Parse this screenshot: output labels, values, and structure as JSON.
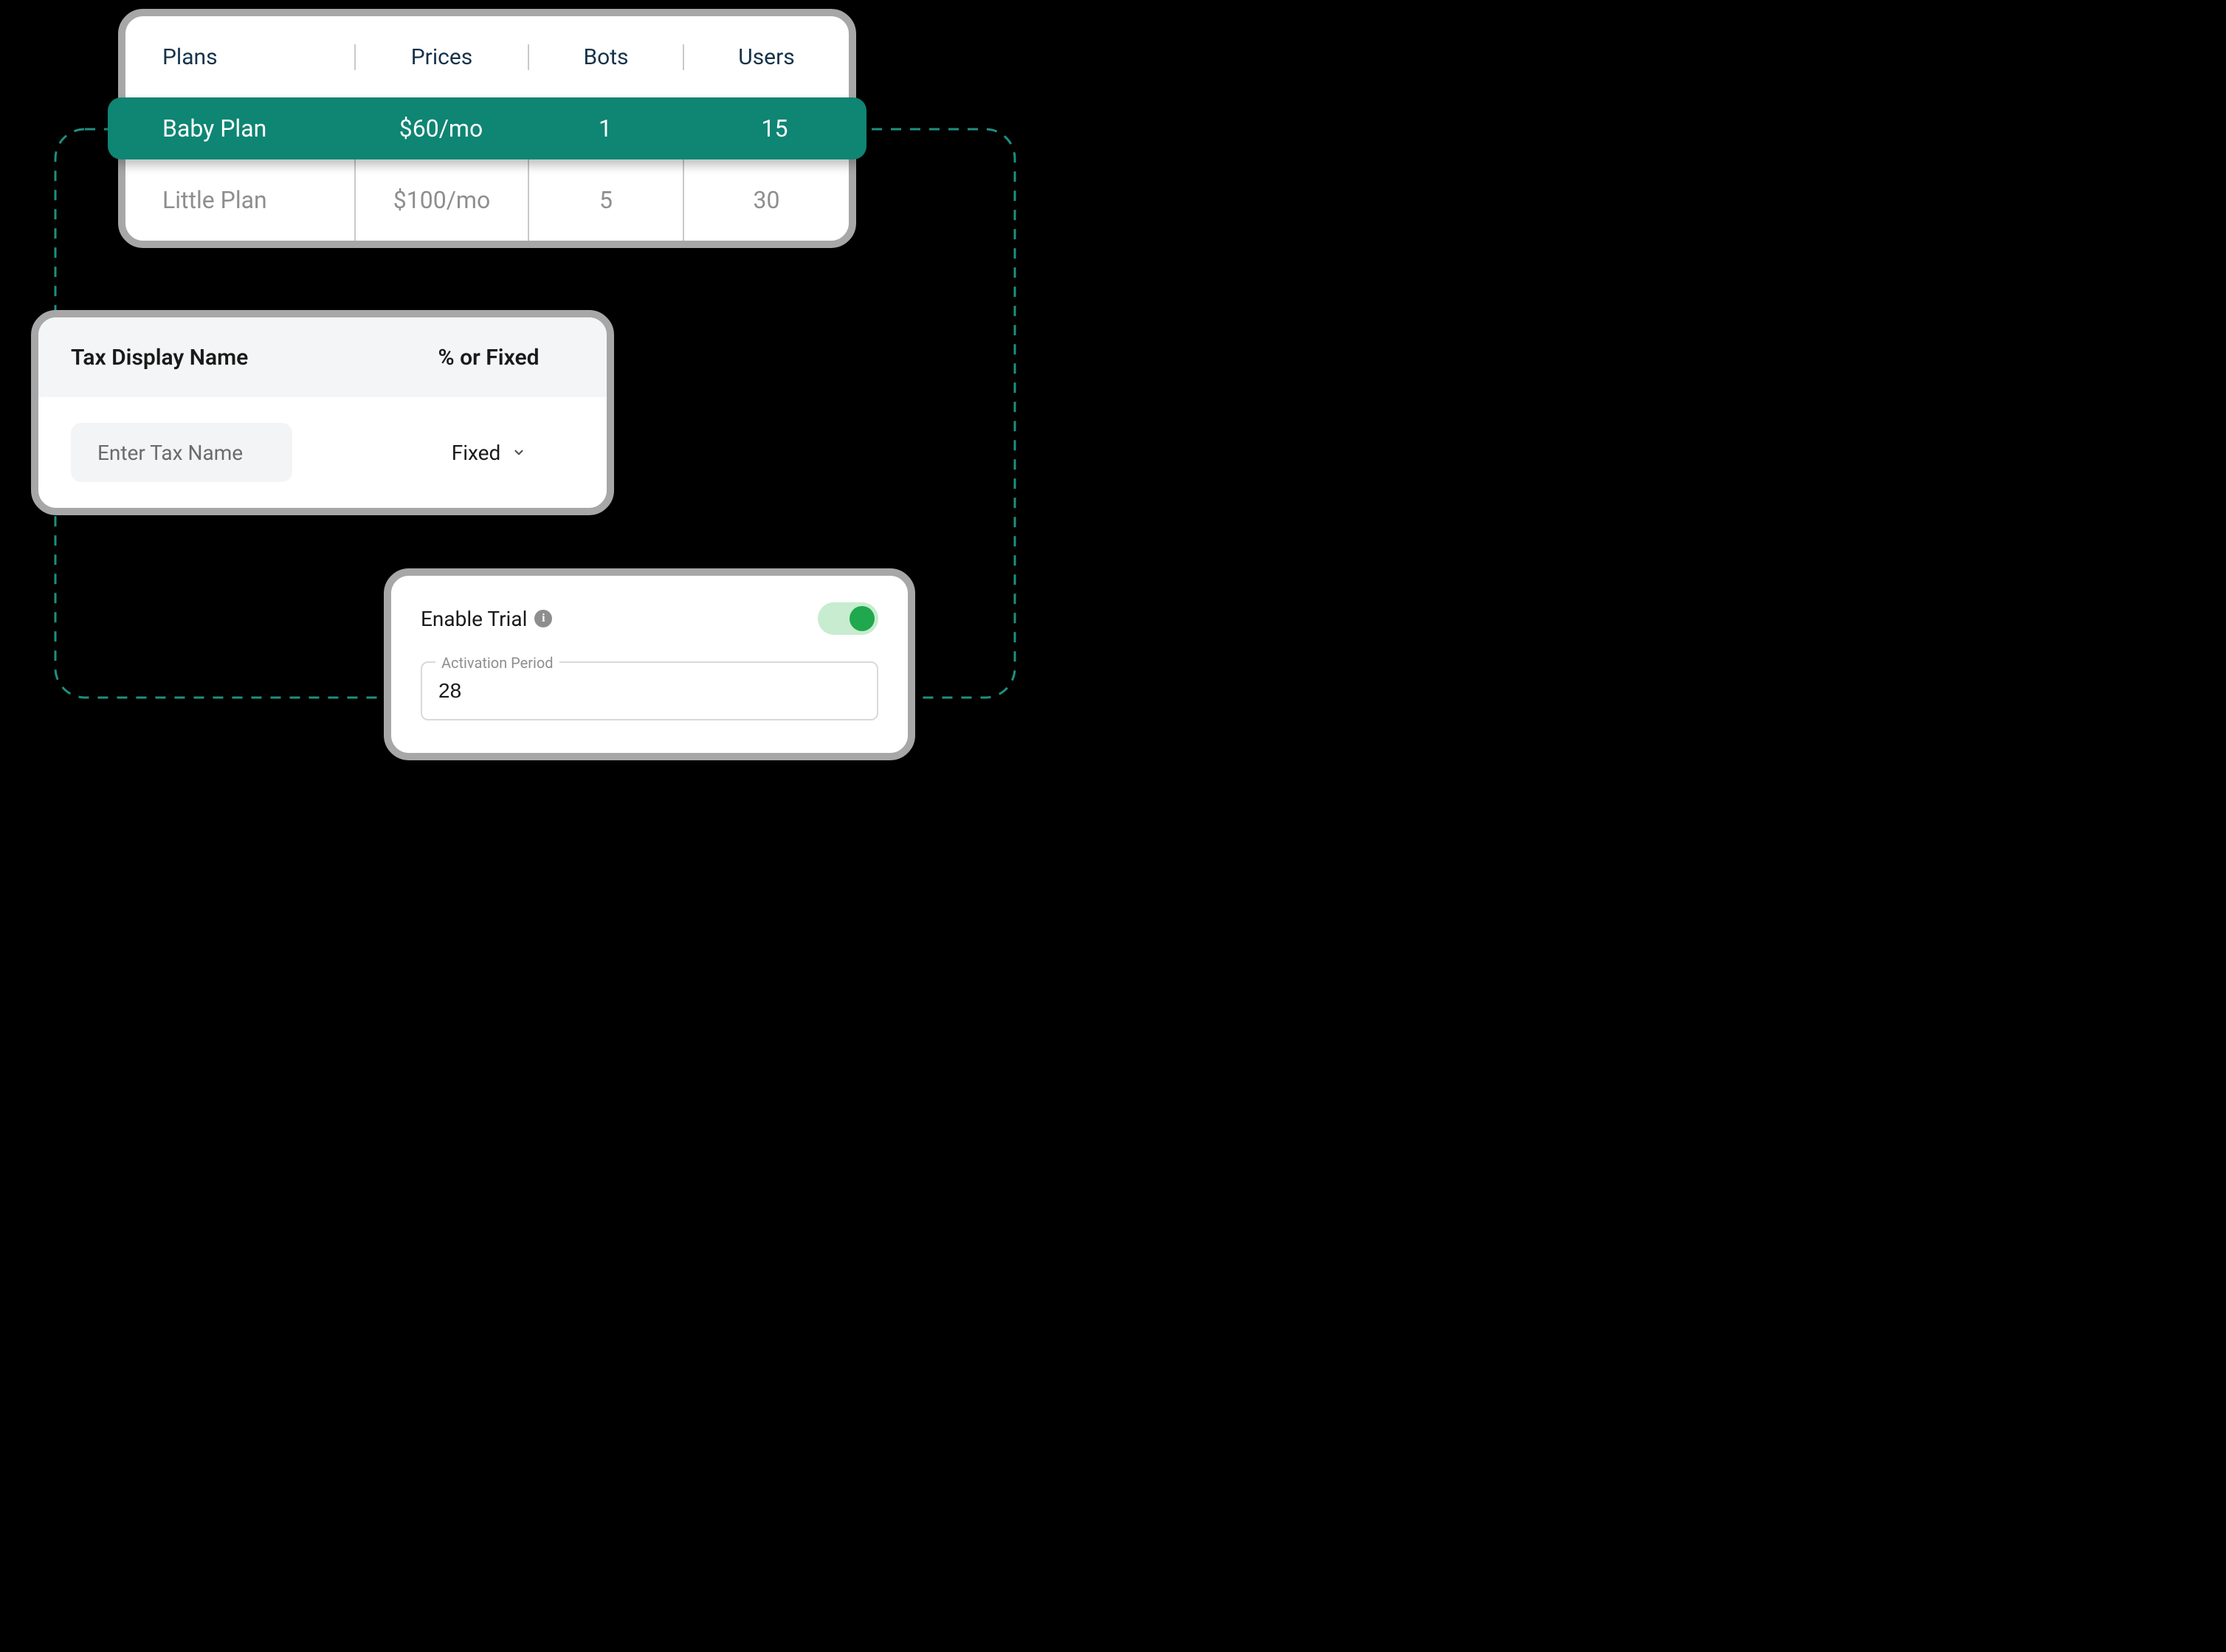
{
  "plans": {
    "headers": [
      "Plans",
      "Prices",
      "Bots",
      "Users"
    ],
    "rows": [
      {
        "name": "Baby Plan",
        "price": "$60/mo",
        "bots": "1",
        "users": "15",
        "selected": true
      },
      {
        "name": "Little Plan",
        "price": "$100/mo",
        "bots": "5",
        "users": "30",
        "selected": false
      }
    ]
  },
  "tax": {
    "header1": "Tax Display Name",
    "header2": "% or Fixed",
    "input_placeholder": "Enter Tax Name",
    "select_value": "Fixed"
  },
  "trial": {
    "label": "Enable Trial",
    "enabled": true,
    "field_label": "Activation Period",
    "field_value": "28"
  },
  "colors": {
    "teal": "#0f8573",
    "border_grey": "#a7a7a7",
    "toggle_track": "#c7eccf",
    "toggle_knob": "#1fa84d"
  }
}
